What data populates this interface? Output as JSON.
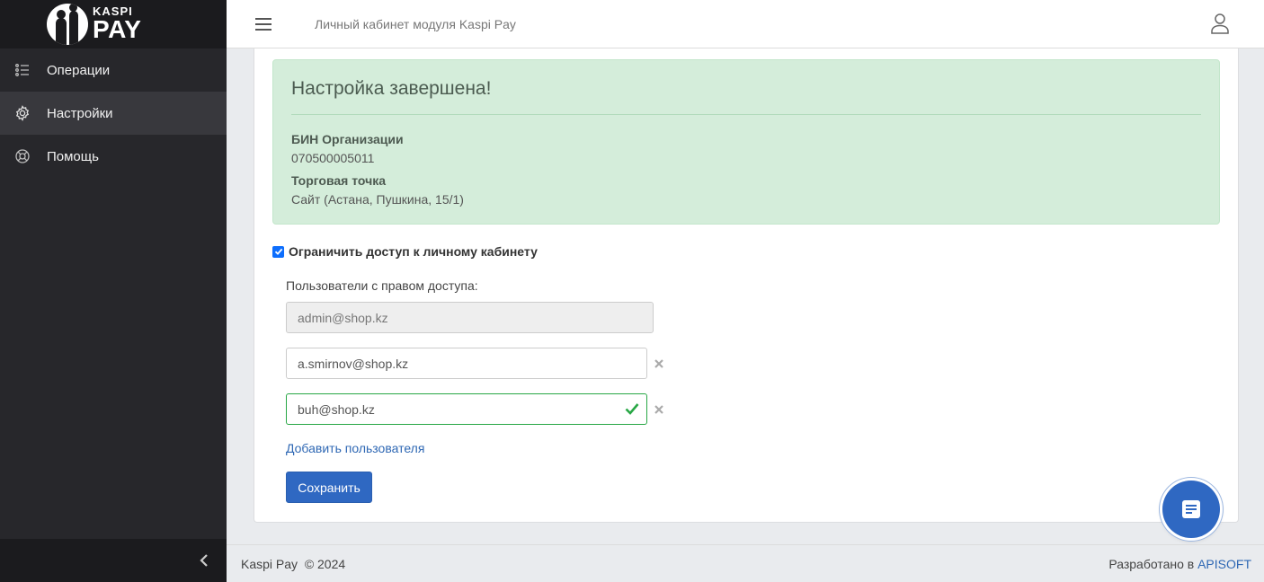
{
  "logo": {
    "small": "KASPI",
    "big": "PAY"
  },
  "sidebar": {
    "items": [
      {
        "label": "Операции",
        "icon": "list-icon"
      },
      {
        "label": "Настройки",
        "icon": "gear-icon",
        "active": true
      },
      {
        "label": "Помощь",
        "icon": "lifebuoy-icon"
      }
    ]
  },
  "header": {
    "title": "Личный кабинет модуля Kaspi Pay"
  },
  "alert": {
    "title": "Настройка завершена!",
    "bin_label": "БИН Организации",
    "bin_value": "070500005011",
    "point_label": "Торговая точка",
    "point_value": "Сайт (Астана, Пушкина, 15/1)"
  },
  "access": {
    "checkbox_label": "Ограничить доступ к личному кабинету",
    "checked": true,
    "users_label": "Пользователи с правом доступа:",
    "users": [
      "admin@shop.kz",
      "a.smirnov@shop.kz",
      "buh@shop.kz"
    ],
    "add_label": "Добавить пользователя",
    "save_label": "Сохранить"
  },
  "footer": {
    "left": "Kaspi Pay  © 2024",
    "right_prefix": "Разработано в ",
    "right_link": "APISOFT"
  },
  "colors": {
    "accent": "#2f68c2",
    "success_bg": "#d4edda",
    "sidebar_bg": "#27272b"
  }
}
